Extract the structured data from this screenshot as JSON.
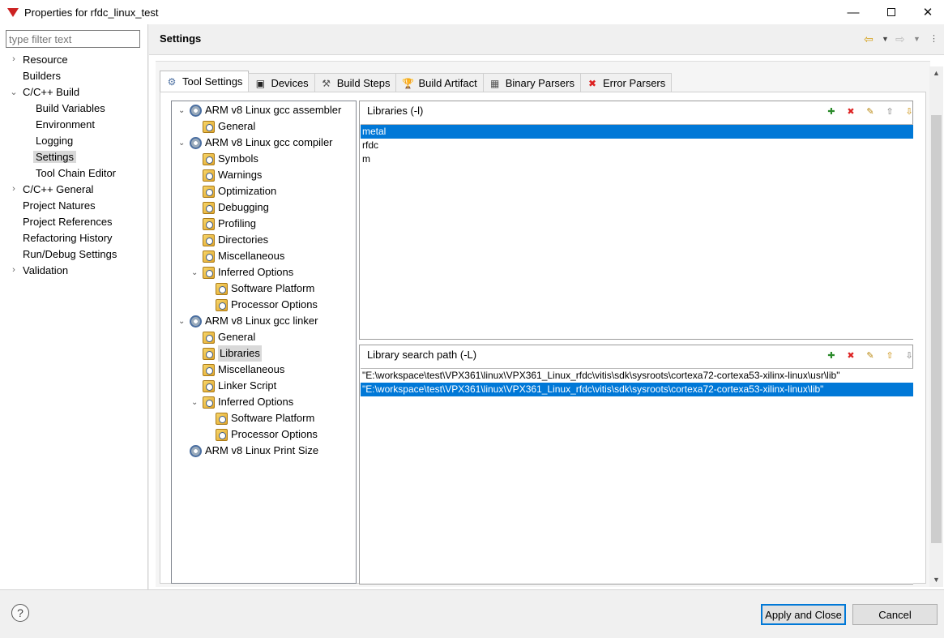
{
  "window": {
    "title": "Properties for rfdc_linux_test",
    "min": "—",
    "close": "✕"
  },
  "filter": {
    "placeholder": "type filter text"
  },
  "nav": {
    "items": [
      {
        "label": "Resource",
        "arrow": "›"
      },
      {
        "label": "Builders",
        "arrow": ""
      },
      {
        "label": "C/C++ Build",
        "arrow": "⌄"
      },
      {
        "label": "Build Variables",
        "arrow": ""
      },
      {
        "label": "Environment",
        "arrow": ""
      },
      {
        "label": "Logging",
        "arrow": ""
      },
      {
        "label": "Settings",
        "arrow": ""
      },
      {
        "label": "Tool Chain Editor",
        "arrow": ""
      },
      {
        "label": "C/C++ General",
        "arrow": "›"
      },
      {
        "label": "Project Natures",
        "arrow": ""
      },
      {
        "label": "Project References",
        "arrow": ""
      },
      {
        "label": "Refactoring History",
        "arrow": ""
      },
      {
        "label": "Run/Debug Settings",
        "arrow": ""
      },
      {
        "label": "Validation",
        "arrow": "›"
      }
    ],
    "selected": "Settings"
  },
  "header": {
    "title": "Settings",
    "icons": [
      "back-icon",
      "dropdown-icon",
      "forward-icon",
      "dropdown-icon",
      "menu-icon"
    ]
  },
  "tabs": [
    {
      "label": "Tool Settings",
      "icon": "tool-settings-icon"
    },
    {
      "label": "Devices",
      "icon": "devices-icon"
    },
    {
      "label": "Build Steps",
      "icon": "build-steps-icon"
    },
    {
      "label": "Build Artifact",
      "icon": "build-artifact-icon"
    },
    {
      "label": "Binary Parsers",
      "icon": "binary-parsers-icon"
    },
    {
      "label": "Error Parsers",
      "icon": "error-parsers-icon"
    }
  ],
  "active_tab": "Tool Settings",
  "tree": [
    {
      "label": "ARM v8 Linux gcc assembler",
      "icon": "gear",
      "arrow": "⌄"
    },
    {
      "label": "General",
      "icon": "folder",
      "arrow": ""
    },
    {
      "label": "ARM v8 Linux gcc compiler",
      "icon": "gear",
      "arrow": "⌄"
    },
    {
      "label": "Symbols",
      "icon": "folder",
      "arrow": ""
    },
    {
      "label": "Warnings",
      "icon": "folder",
      "arrow": ""
    },
    {
      "label": "Optimization",
      "icon": "folder",
      "arrow": ""
    },
    {
      "label": "Debugging",
      "icon": "folder",
      "arrow": ""
    },
    {
      "label": "Profiling",
      "icon": "folder",
      "arrow": ""
    },
    {
      "label": "Directories",
      "icon": "folder",
      "arrow": ""
    },
    {
      "label": "Miscellaneous",
      "icon": "folder",
      "arrow": ""
    },
    {
      "label": "Inferred Options",
      "icon": "folder",
      "arrow": "⌄"
    },
    {
      "label": "Software Platform",
      "icon": "folder",
      "arrow": ""
    },
    {
      "label": "Processor Options",
      "icon": "folder",
      "arrow": ""
    },
    {
      "label": "ARM v8 Linux gcc linker",
      "icon": "gear",
      "arrow": "⌄"
    },
    {
      "label": "General",
      "icon": "folder",
      "arrow": ""
    },
    {
      "label": "Libraries",
      "icon": "folder",
      "arrow": ""
    },
    {
      "label": "Miscellaneous",
      "icon": "folder",
      "arrow": ""
    },
    {
      "label": "Linker Script",
      "icon": "folder",
      "arrow": ""
    },
    {
      "label": "Inferred Options",
      "icon": "folder",
      "arrow": "⌄"
    },
    {
      "label": "Software Platform",
      "icon": "folder",
      "arrow": ""
    },
    {
      "label": "Processor Options",
      "icon": "folder",
      "arrow": ""
    },
    {
      "label": "ARM v8 Linux Print Size",
      "icon": "gear",
      "arrow": ""
    }
  ],
  "tree_selected": "Libraries",
  "libraries": {
    "title": "Libraries (-l)",
    "items": [
      "metal",
      "rfdc",
      "m"
    ],
    "selected_index": 0
  },
  "search_path": {
    "title": "Library search path (-L)",
    "items": [
      "\"E:\\workspace\\test\\VPX361\\linux\\VPX361_Linux_rfdc\\vitis\\sdk\\sysroots\\cortexa72-cortexa53-xilinx-linux\\usr\\lib\"",
      "\"E:\\workspace\\test\\VPX361\\linux\\VPX361_Linux_rfdc\\vitis\\sdk\\sysroots\\cortexa72-cortexa53-xilinx-linux\\lib\""
    ],
    "selected_index": 1
  },
  "panel_tools": [
    "add-icon",
    "delete-icon",
    "edit-icon",
    "move-up-icon",
    "move-down-icon"
  ],
  "buttons": {
    "help": "?",
    "apply_close": "Apply and Close",
    "cancel": "Cancel"
  },
  "colors": {
    "selection": "#0078d7",
    "tree_selection": "#d9d9d9"
  }
}
